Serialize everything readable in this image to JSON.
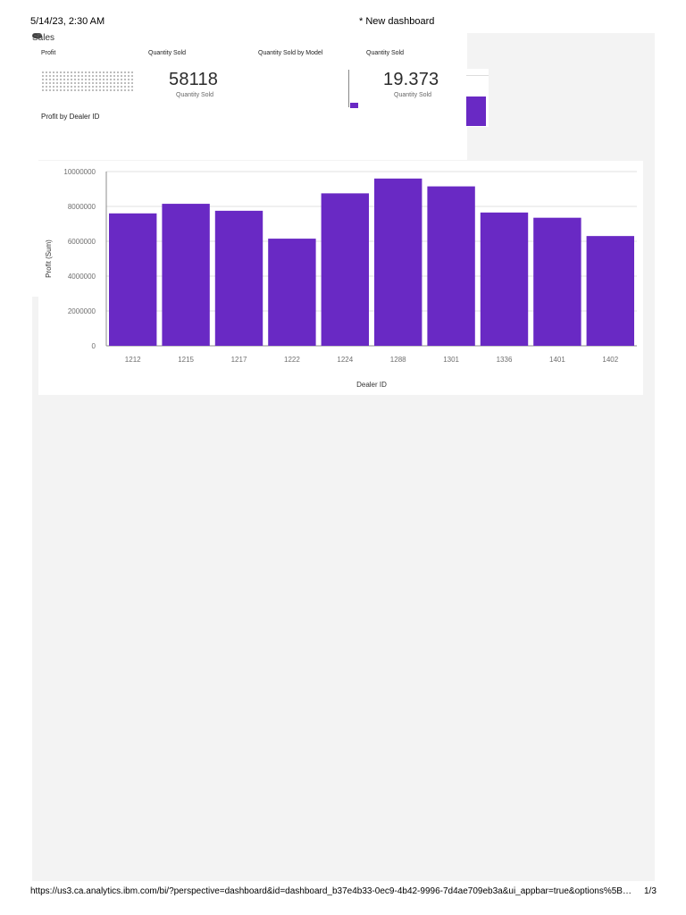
{
  "print_header": {
    "datetime": "5/14/23, 2:30 AM",
    "title": "* New dashboard"
  },
  "print_footer": {
    "url": "https://us3.ca.analytics.ibm.com/bi/?perspective=dashboard&id=dashboard_b37e4b33-0ec9-4b42-9996-7d4ae709eb3a&ui_appbar=true&options%5B…",
    "page": "1/3"
  },
  "tab": {
    "title": "Sales"
  },
  "widgets": {
    "profit_label": "Profit",
    "quantity_sold_label": "Quantity Sold",
    "quantity_by_model_label": "Quantity Sold by Model",
    "quantity_sold_label_2": "Quantity Sold"
  },
  "kpis": {
    "quantity_sold_value": "58118",
    "quantity_sold_caption": "Quantity Sold",
    "quantity_sold_value_2": "19.373",
    "quantity_sold_caption_2": "Quantity Sold"
  },
  "colors": {
    "bar": "#6929c4",
    "canvas": "#f3f3f3",
    "grid": "#e0e0e0",
    "axis": "#8d8d8d"
  },
  "chart_data": {
    "type": "bar",
    "title": "Profit by Dealer ID",
    "xlabel": "Dealer ID",
    "ylabel": "Profit (Sum)",
    "categories": [
      "1212",
      "1215",
      "1217",
      "1222",
      "1224",
      "1288",
      "1301",
      "1336",
      "1401",
      "1402"
    ],
    "values": [
      7600000,
      8150000,
      7750000,
      6150000,
      8750000,
      9600000,
      9150000,
      7650000,
      7350000,
      6300000
    ],
    "ylim": [
      0,
      10000000
    ],
    "yticks": [
      "0",
      "2000000",
      "4000000",
      "6000000",
      "8000000",
      "10000000"
    ],
    "grid": true
  }
}
